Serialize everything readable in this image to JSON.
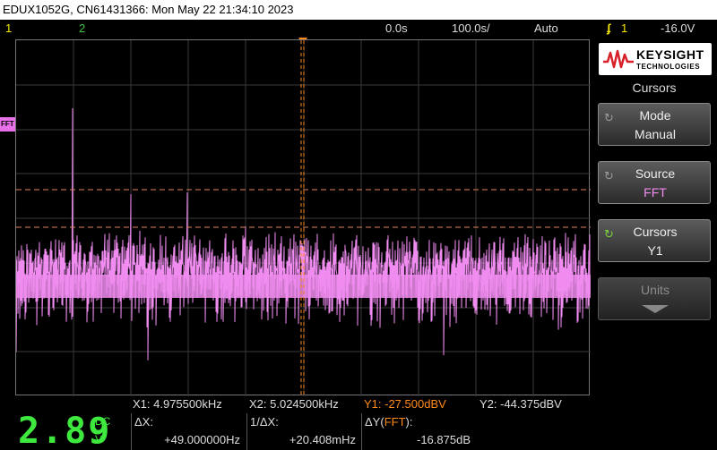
{
  "title_bar": {
    "text": "EDUX1052G, CN61431366: Mon May 22 21:34:10 2023"
  },
  "status": {
    "ch1": "1",
    "ch2": "2",
    "time_delay": "0.0s",
    "time_scale": "100.0s/",
    "trigger_mode": "Auto",
    "trigger_icon": "trigger-edge-icon",
    "trigger_source": "1",
    "trigger_level": "-16.0V"
  },
  "colors": {
    "fft_trace": "#f08cf0",
    "cursor_y1": "#ff8a1a",
    "cursor_y2": "#e0825a",
    "ch1": "#f5e600",
    "ch2": "#3ec43e",
    "dvm": "#3fe83f"
  },
  "display": {
    "fft_marker": "FFT"
  },
  "logo": {
    "name": "KEYSIGHT",
    "sub": "TECHNOLOGIES"
  },
  "menu": {
    "title": "Cursors",
    "softkeys": [
      {
        "label": "Mode",
        "value": "Manual",
        "icon": "rotate-knob-icon"
      },
      {
        "label": "Source",
        "value": "FFT",
        "icon": "rotate-knob-icon"
      },
      {
        "label": "Cursors",
        "value": "Y1",
        "icon": "rotate-knob-active-icon"
      },
      {
        "label": "Units",
        "value": "",
        "icon": "chevron-down-icon"
      }
    ]
  },
  "cursor_readout": {
    "x1": "X1:  4.975500kHz",
    "x2": "X2:  5.024500kHz",
    "y1": "Y1: -27.500dBV",
    "y2": "Y2: -44.375dBV"
  },
  "measurements": {
    "dvm_value": "2.89",
    "dvm_mode": "DC",
    "dvm_unit": "V",
    "delta_x_label": "ΔX:",
    "delta_x_value": "+49.000000Hz",
    "inv_delta_x_label": "1/ΔX:",
    "inv_delta_x_value": "+20.408mHz",
    "delta_y_label": "ΔY(",
    "delta_y_source": "FFT",
    "delta_y_close": "):",
    "delta_y_value": "-16.875dB"
  }
}
